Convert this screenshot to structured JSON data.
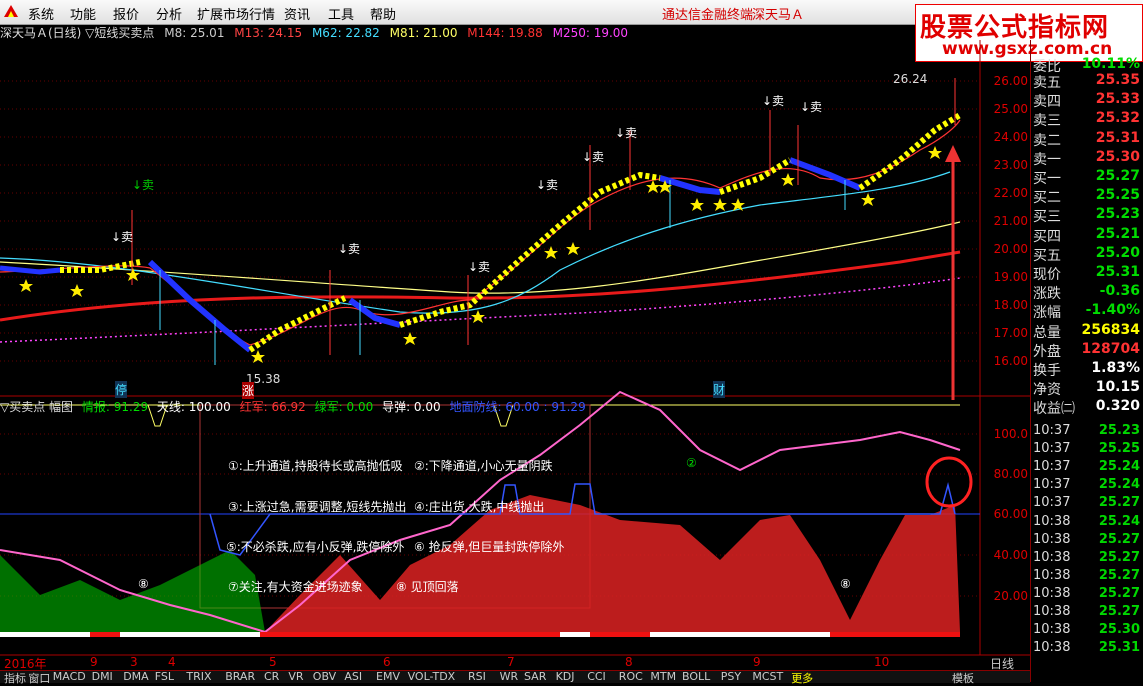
{
  "menu": {
    "items": [
      "系统",
      "功能",
      "报价",
      "分析",
      "扩展市场行情",
      "资讯",
      "工具",
      "帮助"
    ],
    "promo_terminal": "通达信金融终端",
    "promo_stock": "深天马Ａ"
  },
  "watermark": {
    "title": "股票公式指标网",
    "url": "www.gsxz.com.cn"
  },
  "main_legend": {
    "title": "深天马Ａ(日线) ▽短线买卖点",
    "ma": [
      {
        "label": "M8: 25.01",
        "color": "#cccccc"
      },
      {
        "label": "M13: 24.15",
        "color": "#ff4444"
      },
      {
        "label": "M62: 22.82",
        "color": "#44ddff"
      },
      {
        "label": "M81: 21.00",
        "color": "#ffff66"
      },
      {
        "label": "M144: 19.88",
        "color": "#ff3333"
      },
      {
        "label": "M250: 19.00",
        "color": "#ff44ff"
      }
    ]
  },
  "price_axis": [
    "26.00",
    "25.00",
    "24.00",
    "23.00",
    "22.00",
    "21.00",
    "20.00",
    "19.00",
    "18.00",
    "17.00",
    "16.00"
  ],
  "price_labels": {
    "high": "26.24",
    "low": "15.38"
  },
  "sell_marks": [
    "↓卖",
    "↓卖",
    "↓卖",
    "↓卖",
    "↓卖",
    "↓卖",
    "↓卖",
    "↓卖",
    "↓卖"
  ],
  "event_marks": [
    "停",
    "涨",
    "财"
  ],
  "sub_legend": {
    "title": "▽买卖点 幅图",
    "items": [
      {
        "label": "情报: 91.29",
        "color": "#00dd00"
      },
      {
        "label": "天线: 100.00",
        "color": "#ffffff"
      },
      {
        "label": "红军: 66.92",
        "color": "#ff3333"
      },
      {
        "label": "绿军: 0.00",
        "color": "#00dd00"
      },
      {
        "label": "导弹: 0.00",
        "color": "#ffffff"
      },
      {
        "label": "地面防线: 60.00 : 91.29",
        "color": "#3355ff"
      }
    ]
  },
  "sub_axis": [
    "100.0",
    "80.00",
    "60.00",
    "40.00",
    "20.00"
  ],
  "annotations": [
    "①:上升通道,持股待长或高抛低吸",
    "②:下降通道,小心无量阴跌",
    "③:上涨过急,需要调整,短线先抛出",
    "④:庄出货,大跌,中线抛出",
    "⑤:不必杀跌,应有小反弹,跌停除外",
    "⑥ 抢反弹,但巨量封跌停除外",
    "⑦关注,有大资金进场迹象",
    "⑧ 见顶回落"
  ],
  "chart_marks": [
    "②",
    "⑧",
    "⑧"
  ],
  "dates": [
    "2016年",
    "9",
    "3",
    "4",
    "5",
    "6",
    "7",
    "8",
    "9",
    "10"
  ],
  "quote_panel": {
    "partial_top": "委比",
    "partial_top_val": "10.11%",
    "rows": [
      {
        "label": "卖五",
        "value": "25.35",
        "color": "#ff3333"
      },
      {
        "label": "卖四",
        "value": "25.33",
        "color": "#ff3333"
      },
      {
        "label": "卖三",
        "value": "25.32",
        "color": "#ff3333"
      },
      {
        "label": "卖二",
        "value": "25.31",
        "color": "#ff3333"
      },
      {
        "label": "卖一",
        "value": "25.30",
        "color": "#ff3333"
      },
      {
        "label": "买一",
        "value": "25.27",
        "color": "#00dd00"
      },
      {
        "label": "买二",
        "value": "25.25",
        "color": "#00dd00"
      },
      {
        "label": "买三",
        "value": "25.23",
        "color": "#00dd00"
      },
      {
        "label": "买四",
        "value": "25.21",
        "color": "#00dd00"
      },
      {
        "label": "买五",
        "value": "25.20",
        "color": "#00dd00"
      },
      {
        "label": "现价",
        "value": "25.31",
        "color": "#00dd00"
      },
      {
        "label": "涨跌",
        "value": "-0.36",
        "color": "#00dd00"
      },
      {
        "label": "涨幅",
        "value": "-1.40%",
        "color": "#00dd00"
      },
      {
        "label": "总量",
        "value": "256834",
        "color": "#ffff00"
      },
      {
        "label": "外盘",
        "value": "128704",
        "color": "#ff3333"
      },
      {
        "label": "换手",
        "value": "1.83%",
        "color": "#ffffff"
      },
      {
        "label": "净资",
        "value": "10.15",
        "color": "#ffffff"
      },
      {
        "label": "收益㈡",
        "value": "0.320",
        "color": "#ffffff"
      }
    ],
    "ticks": [
      {
        "time": "10:37",
        "price": "25.23"
      },
      {
        "time": "10:37",
        "price": "25.25"
      },
      {
        "time": "10:37",
        "price": "25.24"
      },
      {
        "time": "10:37",
        "price": "25.24"
      },
      {
        "time": "10:37",
        "price": "25.27"
      },
      {
        "time": "10:38",
        "price": "25.24"
      },
      {
        "time": "10:38",
        "price": "25.27"
      },
      {
        "time": "10:38",
        "price": "25.27"
      },
      {
        "time": "10:38",
        "price": "25.27"
      },
      {
        "time": "10:38",
        "price": "25.27"
      },
      {
        "time": "10:38",
        "price": "25.27"
      },
      {
        "time": "10:38",
        "price": "25.30"
      },
      {
        "time": "10:38",
        "price": "25.31"
      }
    ]
  },
  "bottom_tabs": [
    "指标",
    "窗口",
    "MACD",
    "DMI",
    "DMA",
    "FSL",
    "TRIX",
    "BRAR",
    "CR",
    "VR",
    "OBV",
    "ASI",
    "EMV",
    "VOL-TDX",
    "RSI",
    "WR",
    "SAR",
    "KDJ",
    "CCI",
    "ROC",
    "MTM",
    "BOLL",
    "PSY",
    "MCST",
    "更多"
  ],
  "bottom_right": {
    "template": "模板",
    "period": "日线"
  }
}
